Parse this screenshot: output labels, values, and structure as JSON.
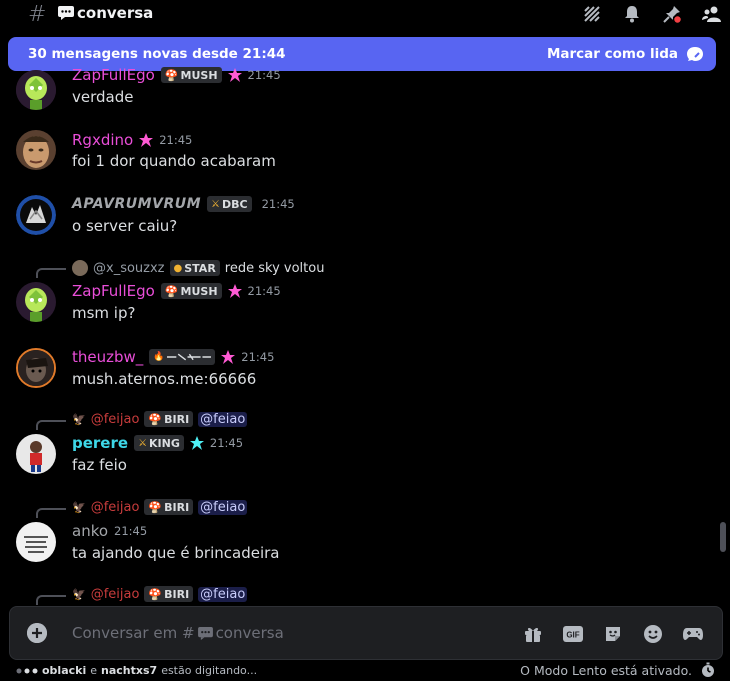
{
  "header": {
    "hash": "#",
    "channel_name": "conversa",
    "icons": [
      "threads-icon",
      "bell-icon",
      "pin-icon",
      "members-icon"
    ]
  },
  "banner": {
    "text": "30 mensagens novas desde 21:44",
    "button_label": "Marcar como lida"
  },
  "messages": [
    {
      "username": "ZapFullEgo",
      "tag": "MUSH",
      "time": "21:45",
      "text": "verdade"
    },
    {
      "username": "Rgxdino",
      "time": "21:45",
      "text": "foi 1 dor quando acabaram"
    },
    {
      "username": "APAVRUMVRUM",
      "tag": "DBC",
      "time": "21:45",
      "text": "o server caiu?"
    },
    {
      "reply_user": "@x_souzxz",
      "reply_tag": "STAR",
      "reply_text": "rede sky voltou",
      "username": "ZapFullEgo",
      "tag": "MUSH",
      "time": "21:45",
      "text": "msm ip?"
    },
    {
      "username": "theuzbw_",
      "tag": "",
      "time": "21:45",
      "text": "mush.aternos.me:66666"
    },
    {
      "reply_user": "@feijao",
      "reply_tag": "BIRI",
      "reply_text": "@feiao",
      "username": "perere",
      "tag": "KING",
      "time": "21:45",
      "text": "faz feio"
    },
    {
      "reply_user": "@feijao",
      "reply_tag": "BIRI",
      "reply_text": "@feiao",
      "username": "anko",
      "time": "21:45",
      "text": "ta ajando que é brincadeira"
    },
    {
      "reply_user": "@feijao",
      "reply_tag": "BIRI",
      "reply_text": "@feiao"
    }
  ],
  "composer": {
    "placeholder_prefix": "Conversar em #",
    "placeholder_channel": "conversa",
    "icons": [
      "gift-icon",
      "gif-icon",
      "sticker-icon",
      "emoji-icon",
      "apps-icon"
    ],
    "gif_label": "GIF"
  },
  "footer": {
    "typing_user1": "oblacki",
    "typing_and": "e",
    "typing_user2": "nachtxs7",
    "typing_suffix": "estão digitando...",
    "slowmode": "O Modo Lento está ativado."
  },
  "colors": {
    "accent": "#5865f2",
    "pink_name": "#e94ed8",
    "cyan_name": "#3ed8e8",
    "red_reply": "#c83c3c",
    "nitro_pink": "#ff5ad4",
    "nitro_cyan": "#4ef0f5"
  }
}
